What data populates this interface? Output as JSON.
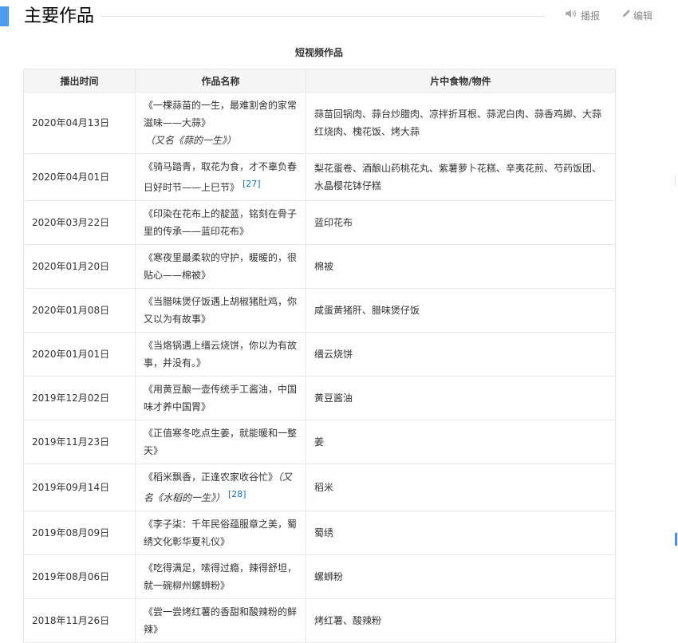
{
  "header": {
    "title": "主要作品",
    "report_label": "播报",
    "edit_label": "编辑",
    "report_icon": "speaker-icon",
    "edit_icon": "pencil-icon"
  },
  "table": {
    "caption": "短视频作品",
    "columns": [
      "播出时间",
      "作品名称",
      "片中食物/物件"
    ],
    "rows": [
      {
        "date": "2020年04月13日",
        "title": "《一棵蒜苗的一生，最难割舍的家常滋味——大蒜》",
        "alias": "（又名《蒜的一生》）",
        "ref": "",
        "items": "蒜苗回锅肉、蒜台炒腊肉、凉拌折耳根、蒜泥白肉、蒜香鸡脚、大蒜红烧肉、槐花饭、烤大蒜"
      },
      {
        "date": "2020年04月01日",
        "title": "《骑马踏青，取花为食，才不辜负春日好时节——上巳节》",
        "alias": "",
        "ref": "[27]",
        "items": "梨花蛋卷、酒酿山药桃花丸、紫薯萝卜花糕、辛夷花煎、芍药饭团、水晶樱花钵仔糕"
      },
      {
        "date": "2020年03月22日",
        "title": "《印染在花布上的靛蓝，铭刻在骨子里的传承——蓝印花布》",
        "alias": "",
        "ref": "",
        "items": "蓝印花布"
      },
      {
        "date": "2020年01月20日",
        "title": "《寒夜里最柔软的守护，暖暖的，很贴心——棉被》",
        "alias": "",
        "ref": "",
        "items": "棉被"
      },
      {
        "date": "2020年01月08日",
        "title": "《当腊味煲仔饭遇上胡椒猪肚鸡，你又以为有故事》",
        "alias": "",
        "ref": "",
        "items": "咸蛋黄猪肝、腊味煲仔饭"
      },
      {
        "date": "2020年01月01日",
        "title": "《当烙锅遇上缙云烧饼，你以为有故事，并没有。》",
        "alias": "",
        "ref": "",
        "items": "缙云烧饼"
      },
      {
        "date": "2019年12月02日",
        "title": "《用黄豆酿一壶传统手工酱油，中国味才养中国胃》",
        "alias": "",
        "ref": "",
        "items": "黄豆酱油"
      },
      {
        "date": "2019年11月23日",
        "title": "《正值寒冬吃点生姜，就能暖和一整天》",
        "alias": "",
        "ref": "",
        "items": "姜"
      },
      {
        "date": "2019年09月14日",
        "title": "《稻米飘香，正逢农家收谷忙》",
        "alias": "（又名《水稻的一生》）",
        "ref": "[28]",
        "items": "稻米"
      },
      {
        "date": "2019年08月09日",
        "title": "《李子柒：千年民俗蕴服章之美，蜀绣文化彰华夏礼仪》",
        "alias": "",
        "ref": "",
        "items": "蜀绣"
      },
      {
        "date": "2019年08月06日",
        "title": "《吃得满足，嗦得过瘾，辣得舒坦，就一碗柳州螺蛳粉》",
        "alias": "",
        "ref": "",
        "items": "螺蛳粉"
      },
      {
        "date": "2018年11月26日",
        "title": "《尝一尝烤红薯的香甜和酸辣粉的鲜辣》",
        "alias": "",
        "ref": "",
        "items": "烤红薯、酸辣粉"
      }
    ]
  }
}
